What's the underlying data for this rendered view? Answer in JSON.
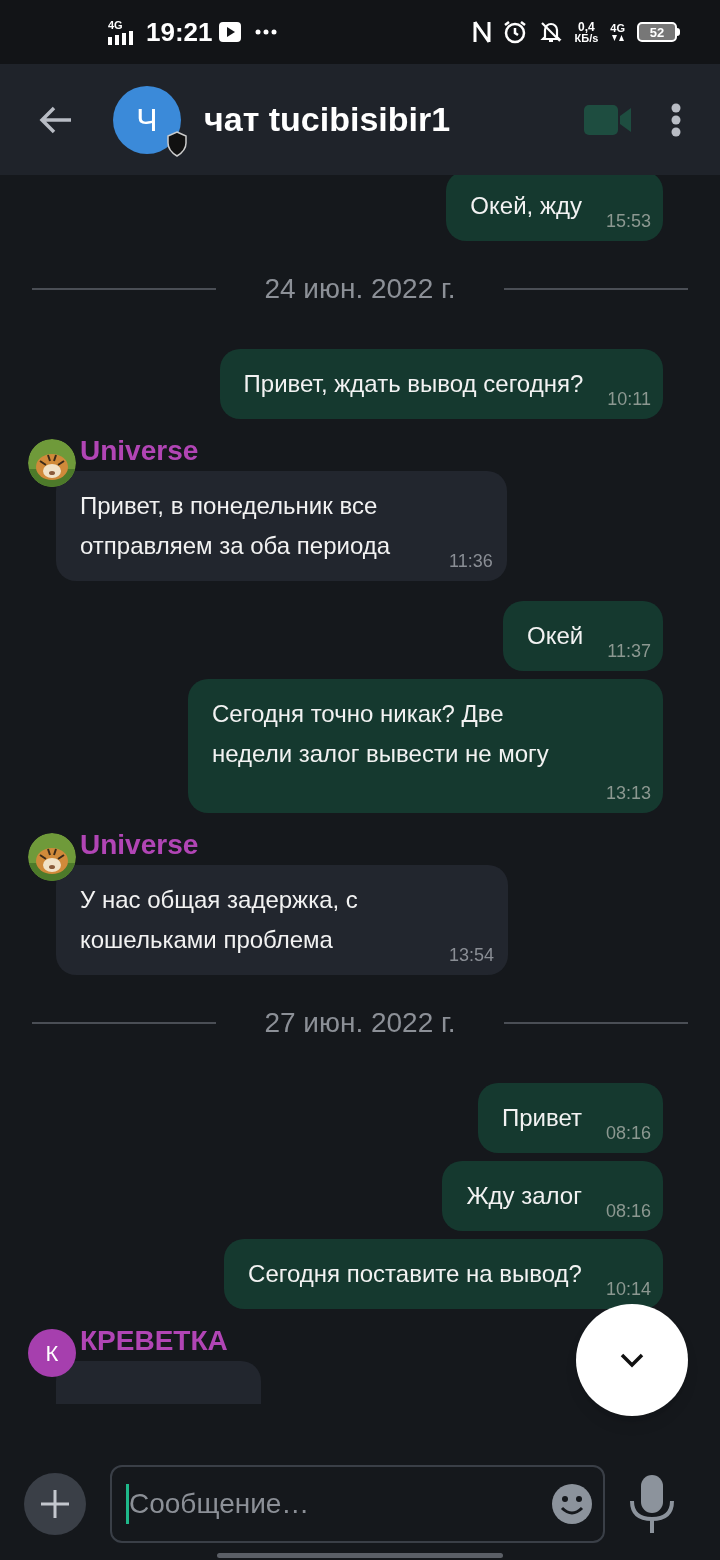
{
  "status_bar": {
    "network": "4G",
    "time": "19:21",
    "speed_value": "0,4",
    "speed_unit": "КБ/s",
    "network_right": "4G",
    "battery": "52"
  },
  "header": {
    "avatar_letter": "Ч",
    "title": "чат tucibisibir1"
  },
  "messages": [
    {
      "kind": "out",
      "text": "Окей, жду",
      "time": "15:53"
    },
    {
      "kind": "date",
      "text": "24 июн. 2022 г."
    },
    {
      "kind": "out",
      "text": "Привет, ждать вывод сегодня?",
      "time": "10:11"
    },
    {
      "kind": "in",
      "sender": "Universe",
      "text": "Привет, в понедельник все отправляем за оба периода",
      "time": "11:36"
    },
    {
      "kind": "out",
      "text": "Окей",
      "time": "11:37"
    },
    {
      "kind": "out",
      "text": "Сегодня точно никак? Две недели залог вывести не могу",
      "time": "13:13"
    },
    {
      "kind": "in",
      "sender": "Universe",
      "text": "У нас общая задержка, с кошельками проблема",
      "time": "13:54"
    },
    {
      "kind": "date",
      "text": "27 июн. 2022 г."
    },
    {
      "kind": "out",
      "text": "Привет",
      "time": "08:16"
    },
    {
      "kind": "out",
      "text": "Жду залог",
      "time": "08:16"
    },
    {
      "kind": "out",
      "text": "Сегодня поставите на вывод?",
      "time": "10:14"
    },
    {
      "kind": "in",
      "sender": "КРЕВЕТКА",
      "avatar_letter": "К"
    }
  ],
  "composer": {
    "placeholder": "Сообщение…"
  }
}
